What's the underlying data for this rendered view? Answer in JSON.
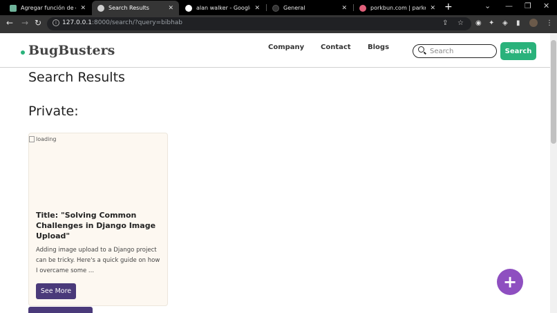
{
  "browser": {
    "tabs": [
      {
        "title": "Agregar función de carg...",
        "close": "✕",
        "color": "#6fb39a"
      },
      {
        "title": "Search Results",
        "close": "✕",
        "color": "#cfcfcf"
      },
      {
        "title": "alan walker - Google Sea...",
        "close": "✕",
        "color": "#ffffff"
      },
      {
        "title": "General",
        "close": "✕",
        "color": "#333333"
      },
      {
        "title": "porkbun.com | parked d...",
        "close": "✕",
        "color": "#e0607a"
      }
    ],
    "new_tab": "+",
    "url_host": "127.0.0.1",
    "url_rest": ":8000/search/?query=bibhab"
  },
  "site": {
    "brand": "BugBusters",
    "nav": [
      "Company",
      "Contact",
      "Blogs"
    ],
    "search_placeholder": "Search",
    "search_button": "Search",
    "accent": "#2ab27b",
    "purple": "#4a3a7a"
  },
  "main": {
    "heading": "Search Results",
    "section": "Private:",
    "card": {
      "img_alt": "loading",
      "title": "Title: \"Solving Common Challenges in Django Image Upload\"",
      "description": "Adding image upload to a Django project can be tricky. Here's a quick guide on how I overcame some ...",
      "button": "See More"
    },
    "fab": "+"
  }
}
